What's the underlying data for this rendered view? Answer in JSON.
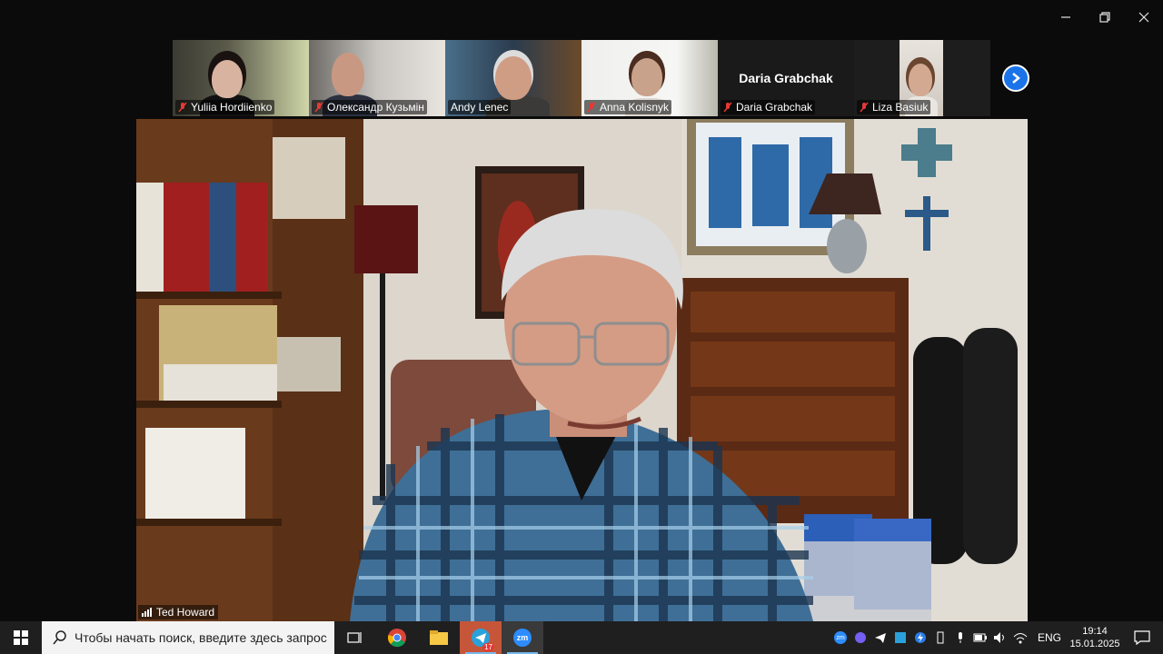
{
  "participants": [
    {
      "name": "Yuliia Hordiienko",
      "muted": true
    },
    {
      "name": "Олександр Кузьмін",
      "muted": true
    },
    {
      "name": "Andy Lenec",
      "muted": false
    },
    {
      "name": "Anna Kolisnyk",
      "muted": true
    },
    {
      "name": "Daria Grabchak",
      "muted": true,
      "video_off": true
    },
    {
      "name": "Liza Basiuk",
      "muted": true
    }
  ],
  "active_speaker": {
    "name": "Ted Howard"
  },
  "taskbar": {
    "search_placeholder": "Чтобы начать поиск, введите здесь запрос",
    "telegram_badge": "17",
    "zoom_label": "zm",
    "tray_zoom_label": "zm",
    "language": "ENG",
    "time": "19:14",
    "date": "15.01.2025"
  },
  "colors": {
    "zoom_blue": "#1a73e8",
    "mic_red": "#e53935",
    "taskbar": "#1f1f1f"
  }
}
